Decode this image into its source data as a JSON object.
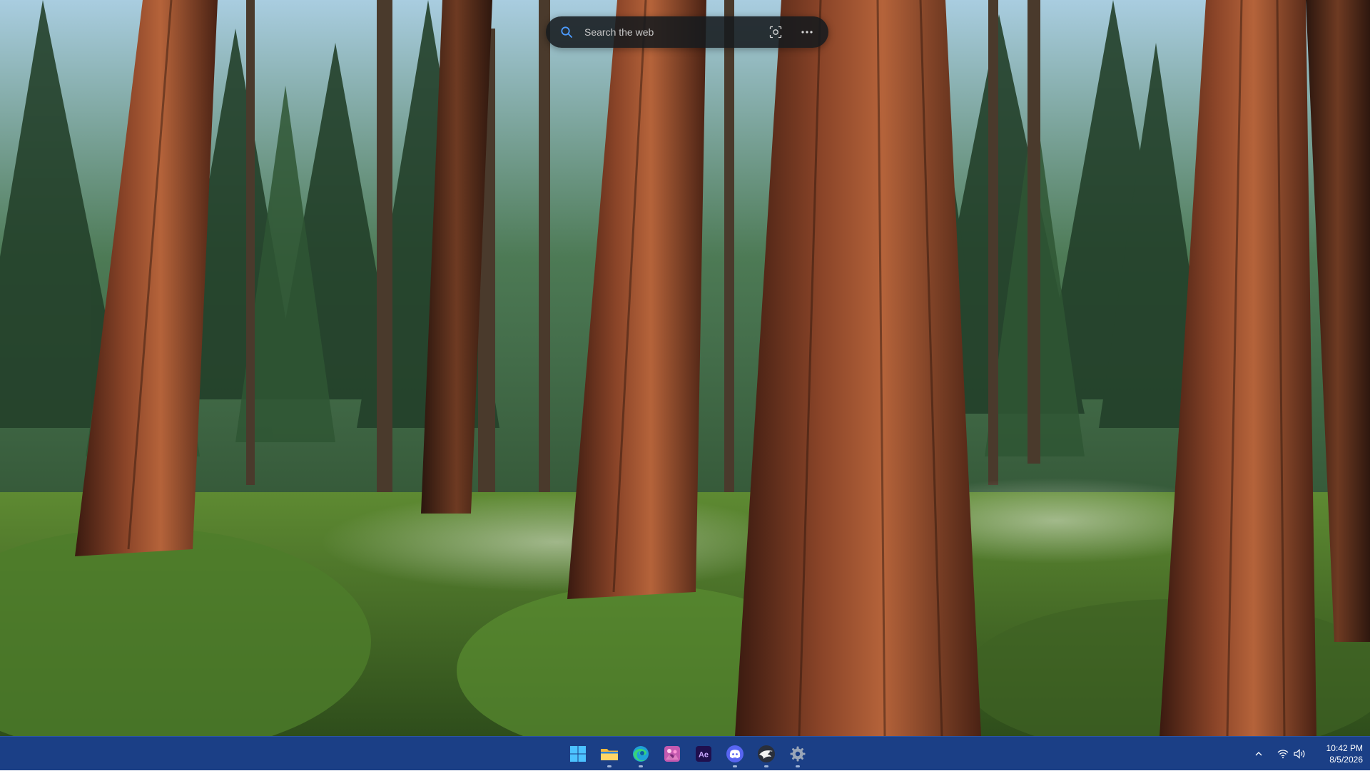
{
  "search": {
    "placeholder": "Search the web",
    "visual_search_icon": "camera-lens-icon",
    "more_icon": "more-dots-icon"
  },
  "taskbar": {
    "background_color": "#1b3f86",
    "apps": [
      {
        "name": "Start",
        "icon": "windows-start-icon",
        "running": false
      },
      {
        "name": "File Explorer",
        "icon": "folder-icon",
        "running": true
      },
      {
        "name": "Microsoft Edge",
        "icon": "edge-icon",
        "running": true
      },
      {
        "name": "App",
        "icon": "pink-app-icon",
        "running": false
      },
      {
        "name": "After Effects",
        "icon": "after-effects-icon",
        "running": false
      },
      {
        "name": "Discord",
        "icon": "discord-icon",
        "running": true
      },
      {
        "name": "App",
        "icon": "eagle-icon",
        "running": true
      },
      {
        "name": "Settings",
        "icon": "settings-gear-icon",
        "running": true
      }
    ],
    "tray": {
      "overflow_icon": "chevron-up-icon",
      "network_icon": "wifi-icon",
      "volume_icon": "speaker-icon"
    },
    "clock": {
      "time": "10:42 PM",
      "date": "8/5/2026"
    }
  },
  "labels": {
    "after_effects": "Ae"
  }
}
